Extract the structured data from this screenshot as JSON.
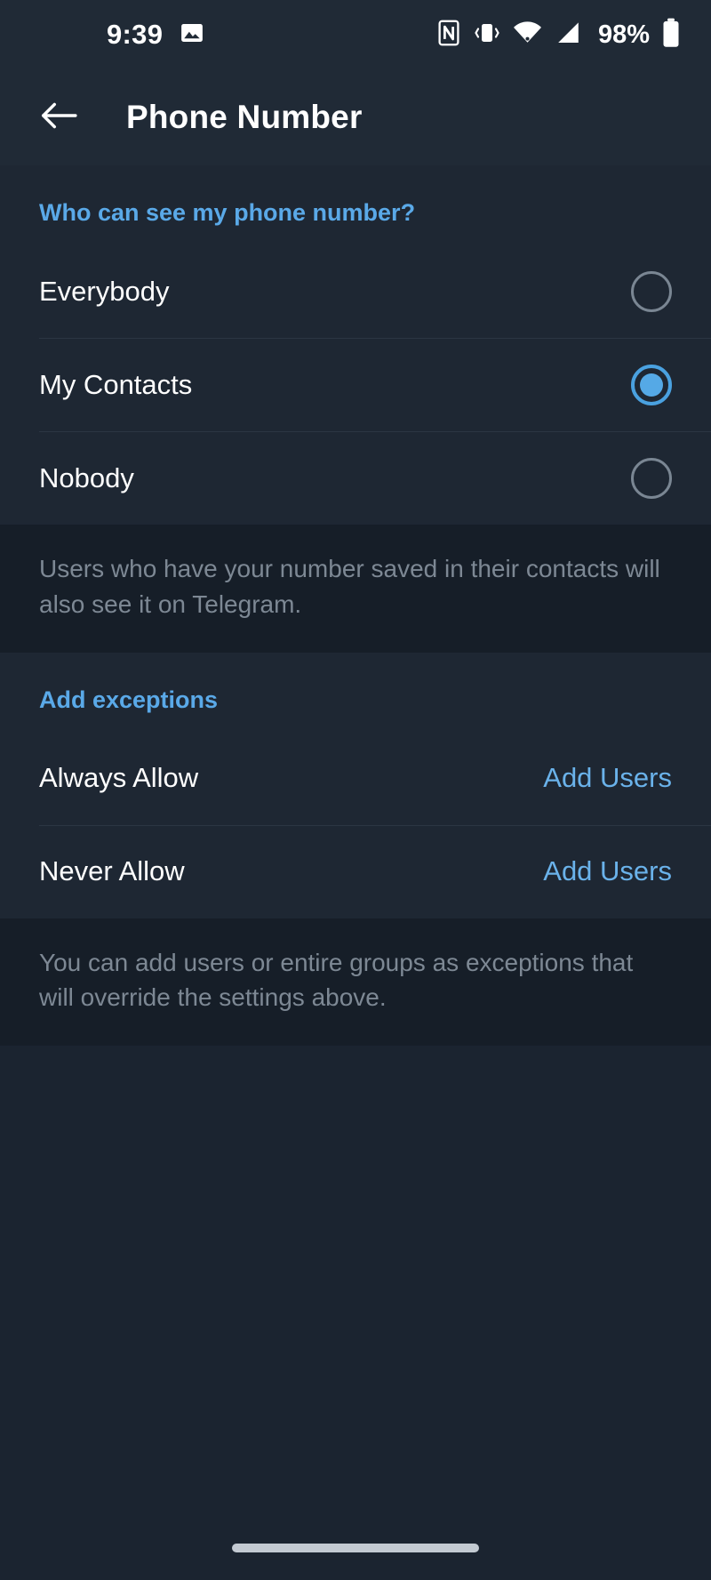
{
  "status_bar": {
    "time": "9:39",
    "battery_percent": "98%",
    "icons": [
      "image-icon",
      "nfc-icon",
      "vibrate-icon",
      "wifi-icon",
      "cellular-signal-icon",
      "battery-icon"
    ]
  },
  "app_bar": {
    "back_icon": "arrow-left-icon",
    "title": "Phone Number"
  },
  "visibility_section": {
    "header": "Who can see my phone number?",
    "options": [
      {
        "label": "Everybody",
        "selected": false
      },
      {
        "label": "My Contacts",
        "selected": true
      },
      {
        "label": "Nobody",
        "selected": false
      }
    ],
    "footnote": "Users who have your number saved in their contacts will also see it on Telegram."
  },
  "exceptions_section": {
    "header": "Add exceptions",
    "rows": [
      {
        "label": "Always Allow",
        "action": "Add Users"
      },
      {
        "label": "Never Allow",
        "action": "Add Users"
      }
    ],
    "footnote": "You can add users or entire groups as exceptions that will override the settings above."
  },
  "nav_bar": {
    "handle": "gesture-home-pill"
  },
  "colors": {
    "accent": "#5aa9e8",
    "link": "#6ab2ea",
    "surface": "#1e2733",
    "background": "#1b2430",
    "appbar": "#202a36",
    "footnote_bg": "#161e28",
    "text_primary": "#ffffff",
    "text_secondary": "#7d8894"
  }
}
